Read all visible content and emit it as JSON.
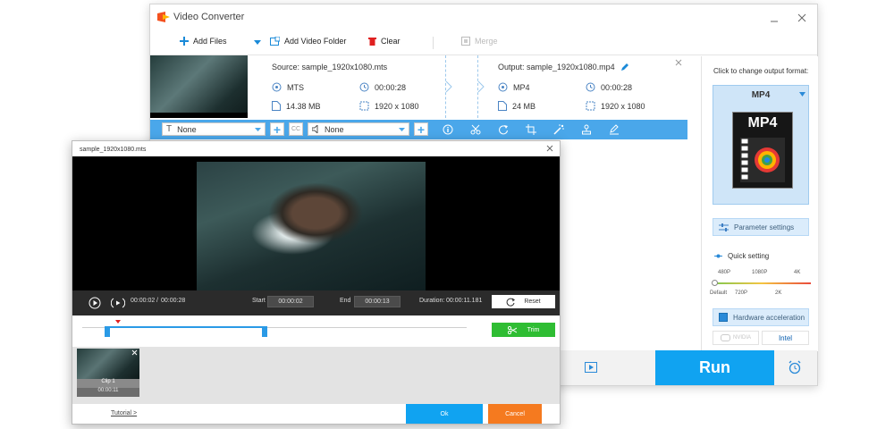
{
  "app": {
    "title": "Video Converter"
  },
  "toolbar": {
    "add_files": "Add Files",
    "add_folder": "Add Video Folder",
    "clear": "Clear",
    "merge": "Merge"
  },
  "source": {
    "filename": "Source: sample_1920x1080.mts",
    "format": "MTS",
    "duration": "00:00:28",
    "size": "14.38 MB",
    "resolution": "1920 x 1080"
  },
  "output": {
    "filename": "Output: sample_1920x1080.mp4",
    "format": "MP4",
    "duration": "00:00:28",
    "size": "24 MB",
    "resolution": "1920 x 1080"
  },
  "editbar": {
    "subtitle_value": "None",
    "audio_value": "None",
    "cc_label": "CC"
  },
  "right_panel": {
    "hint": "Click to change output format:",
    "format": "MP4",
    "format_badge": "MP4",
    "parameter_settings": "Parameter settings",
    "quick_setting": "Quick setting",
    "quality_top": [
      "480P",
      "1080P",
      "4K"
    ],
    "quality_bottom": [
      "Default",
      "720P",
      "2K"
    ],
    "hardware_acceleration": "Hardware acceleration",
    "gpu_nvidia": "NVIDIA",
    "gpu_intel": "Intel"
  },
  "run": {
    "label": "Run"
  },
  "dialog": {
    "title": "sample_1920x1080.mts",
    "current_time": "00:00:02",
    "slash": "/",
    "total_time": "00:00:28",
    "start_label": "Start",
    "start_value": "00:00:02",
    "end_label": "End",
    "end_value": "00:00:13",
    "duration_label": "Duration:",
    "duration_value": "00:00:11.181",
    "reset": "Reset",
    "trim": "Trim",
    "clip_label": "Clip 1",
    "clip_time": "00:00:11",
    "tutorial": "Tutorial >",
    "ok": "Ok",
    "cancel": "Cancel"
  },
  "colors": {
    "accent": "#10a3f1",
    "edit_bar": "#4aa7ea",
    "trim": "#2fbd33",
    "cancel": "#f57a1f",
    "delete": "#e02020"
  }
}
